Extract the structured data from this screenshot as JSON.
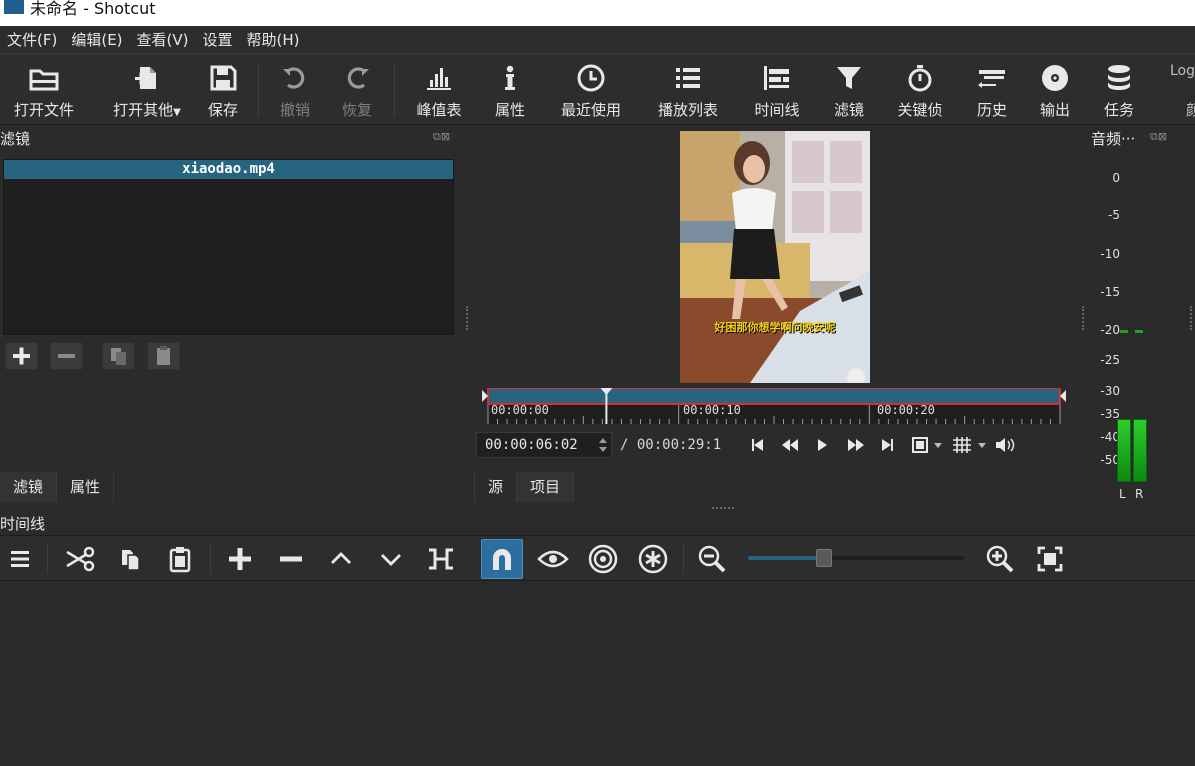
{
  "window": {
    "title": "未命名 - Shotcut"
  },
  "menu": [
    {
      "label": "文件(F)"
    },
    {
      "label": "编辑(E)"
    },
    {
      "label": "查看(V)"
    },
    {
      "label": "设置"
    },
    {
      "label": "帮助(H)"
    }
  ],
  "toolbar": {
    "open_file": "打开文件",
    "open_other": "打开其他",
    "save": "保存",
    "undo": "撤销",
    "redo": "恢复",
    "peak_meter": "峰值表",
    "properties": "属性",
    "recent": "最近使用",
    "playlist": "播放列表",
    "timeline": "时间线",
    "filters": "滤镜",
    "keyframes": "关键侦",
    "history": "历史",
    "export": "输出",
    "jobs": "任务",
    "log_partial": "Log",
    "overflow_partial": "颜"
  },
  "filter_panel": {
    "title": "滤镜",
    "selected_clip": "xiaodao.mp4",
    "tabs": [
      {
        "label": "滤镜"
      },
      {
        "label": "属性"
      }
    ]
  },
  "player": {
    "subtitle": "好困那你想学啊问晚安呢",
    "ruler": [
      "00:00:00",
      "00:00:10",
      "00:00:20"
    ],
    "playhead_fraction": 0.207,
    "timecode": "00:00:06:02",
    "duration": "/ 00:00:29:1",
    "tabs": [
      {
        "label": "源"
      },
      {
        "label": "项目"
      }
    ]
  },
  "audio_meter": {
    "title": "音频···",
    "scale": [
      "0",
      "-5",
      "-10",
      "-15",
      "-20",
      "-25",
      "-30",
      "-35",
      "-40",
      "-50"
    ],
    "channels": [
      "L",
      "R"
    ],
    "level_fraction": 0.2
  },
  "timeline": {
    "title": "时间线",
    "zoom_fraction": 0.35
  },
  "colors": {
    "accent": "#26647f",
    "meter_green": "#1fa31f",
    "snap_active": "#2a6fa0",
    "scrub_red": "#d03030"
  }
}
